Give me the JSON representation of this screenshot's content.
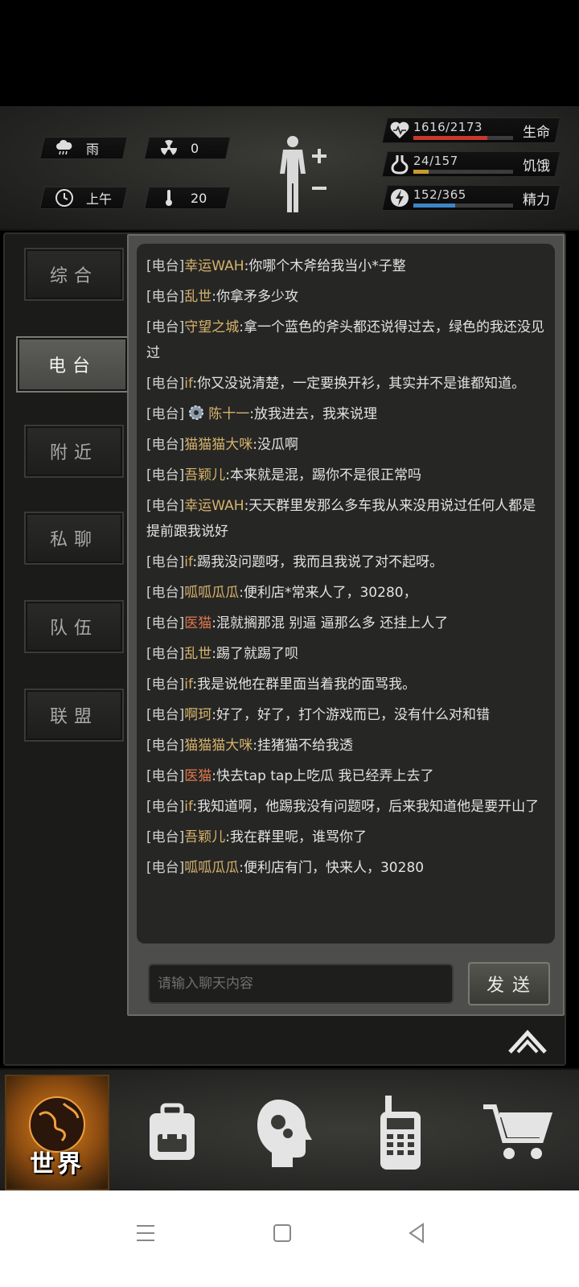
{
  "status": {
    "weather": "雨",
    "radiation": "0",
    "time_of_day": "上午",
    "temperature": "20",
    "vitals": [
      {
        "label": "生命",
        "value": "1616/2173",
        "fill": 0.74,
        "color": "#c9382c",
        "icon": "heart-pulse-icon"
      },
      {
        "label": "饥饿",
        "value": "24/157",
        "fill": 0.15,
        "color": "#c99a2e",
        "icon": "stomach-icon"
      },
      {
        "label": "精力",
        "value": "152/365",
        "fill": 0.42,
        "color": "#3d86c6",
        "icon": "energy-icon"
      }
    ]
  },
  "tabs": [
    "综合",
    "电台",
    "附近",
    "私聊",
    "队伍",
    "联盟"
  ],
  "active_tab": "电台",
  "channel_tag": "[电台]",
  "messages": [
    {
      "name": "幸运WAH",
      "text": ":你哪个木斧给我当小*子整",
      "color": "gold"
    },
    {
      "name": "乱世",
      "text": ":你拿矛多少攻",
      "color": "gold"
    },
    {
      "name": "守望之城",
      "text": ":拿一个蓝色的斧头都还说得过去，绿色的我还没见过",
      "color": "gold"
    },
    {
      "name": "if",
      "text": ":你又没说清楚，一定要换开衫，其实并不是谁都知道。",
      "color": "gold"
    },
    {
      "name": "陈十一",
      "text": ":放我进去，我来说理",
      "color": "gold",
      "badge": true
    },
    {
      "name": "猫猫猫大咪",
      "text": ":没瓜啊",
      "color": "gold"
    },
    {
      "name": "吾颖儿",
      "text": ":本来就是混，踢你不是很正常吗",
      "color": "gold"
    },
    {
      "name": "幸运WAH",
      "text": ":天天群里发那么多车我从来没用说过任何人都是提前跟我说好",
      "color": "gold"
    },
    {
      "name": "if",
      "text": ":踢我没问题呀，我而且我说了对不起呀。",
      "color": "gold"
    },
    {
      "name": "呱呱瓜瓜",
      "text": ":便利店*常来人了，30280，",
      "color": "gold"
    },
    {
      "name": "医猫",
      "text": ":混就搁那混 别逼 逼那么多 还挂上人了",
      "color": "orange"
    },
    {
      "name": "乱世",
      "text": ":踢了就踢了呗",
      "color": "gold"
    },
    {
      "name": "if",
      "text": ":我是说他在群里面当着我的面骂我。",
      "color": "gold"
    },
    {
      "name": "啊珂",
      "text": ":好了，好了，打个游戏而已，没有什么对和错",
      "color": "gold"
    },
    {
      "name": "猫猫猫大咪",
      "text": ":挂猪猫不给我透",
      "color": "gold"
    },
    {
      "name": "医猫",
      "text": ":快去tap tap上吃瓜 我已经弄上去了",
      "color": "orange"
    },
    {
      "name": "if",
      "text": ":我知道啊，他踢我没有问题呀，后来我知道他是要开山了",
      "color": "gold"
    },
    {
      "name": "吾颖儿",
      "text": ":我在群里呢，谁骂你了",
      "color": "gold"
    },
    {
      "name": "呱呱瓜瓜",
      "text": ":便利店有门，快来人，30280",
      "color": "gold"
    }
  ],
  "input": {
    "placeholder": "请输入聊天内容"
  },
  "send_label": "发送",
  "bottom_nav": {
    "world_label": "世界"
  },
  "colors": {
    "accent_gold": "#d7b36b",
    "accent_orange": "#e0784d"
  }
}
